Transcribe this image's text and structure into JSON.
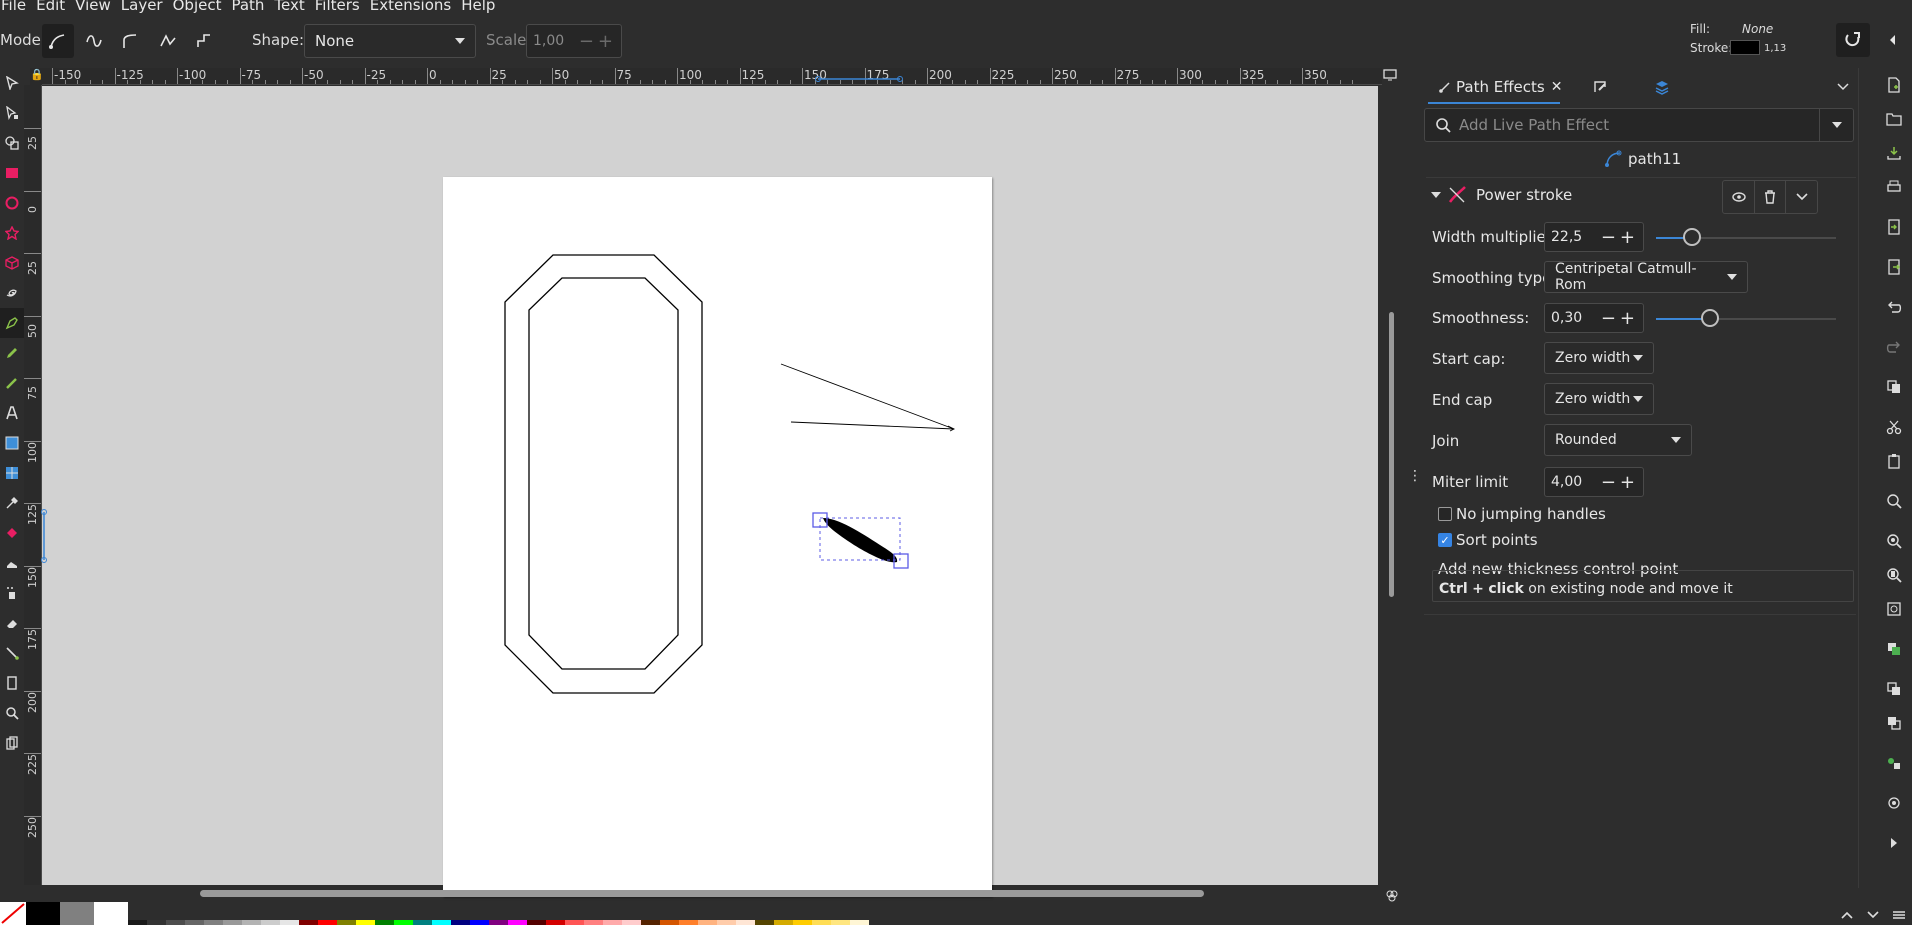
{
  "menu": [
    "File",
    "Edit",
    "View",
    "Layer",
    "Object",
    "Path",
    "Text",
    "Filters",
    "Extensions",
    "Help"
  ],
  "toolbar": {
    "mode_label": "Mode:",
    "shape_label": "Shape:",
    "shape_value": "None",
    "scale_label": "Scale:",
    "scale_value": "1,00",
    "fill_label": "Fill:",
    "fill_value": "None",
    "stroke_label": "Stroke:",
    "stroke_width": "1,13"
  },
  "ruler_top": [
    "-150",
    "-125",
    "-100",
    "-75",
    "-50",
    "-25",
    "0",
    "25",
    "50",
    "75",
    "100",
    "125",
    "150",
    "175",
    "200",
    "225",
    "250",
    "275",
    "300",
    "325",
    "350"
  ],
  "ruler_left": [
    "25",
    "0",
    "25",
    "50",
    "75",
    "100",
    "125",
    "150",
    "175",
    "200",
    "225",
    "250"
  ],
  "panel": {
    "tab_path_effects": "Path Effects",
    "search_placeholder": "Add Live Path Effect",
    "object_name": "path11",
    "effect_name": "Power stroke",
    "width_multiplier_label": "Width multiplier",
    "width_multiplier_value": "22,5",
    "width_multiplier_level": 0.2,
    "smoothing_type_label": "Smoothing type",
    "smoothing_type_value": "Centripetal Catmull-Rom",
    "smoothness_label": "Smoothness:",
    "smoothness_value": "0,30",
    "smoothness_level": 0.3,
    "start_cap_label": "Start cap:",
    "start_cap_value": "Zero width",
    "end_cap_label": "End cap",
    "end_cap_value": "Zero width",
    "join_label": "Join",
    "join_value": "Rounded",
    "miter_limit_label": "Miter limit",
    "miter_limit_value": "4,00",
    "no_jumping_label": "No jumping handles",
    "no_jumping_checked": false,
    "sort_points_label": "Sort points",
    "sort_points_checked": true,
    "help_title": "Add new thickness control point",
    "help_ctrl": "Ctrl",
    "help_plus": "+",
    "help_click": "click",
    "help_rest": "on existing node and move it"
  },
  "palette": [
    "#000000",
    "#808080",
    "#ffffff",
    "#1a1a1a",
    "#333333",
    "#4d4d4d",
    "#666666",
    "#808080",
    "#999999",
    "#b3b3b3",
    "#cccccc",
    "#e6e6e6",
    "#800000",
    "#ff0000",
    "#808000",
    "#ffff00",
    "#008000",
    "#00ff00",
    "#008080",
    "#00ffff",
    "#000080",
    "#0000ff",
    "#800080",
    "#ff00ff",
    "#550000",
    "#d40000",
    "#ff5555",
    "#ff8080",
    "#ffaaaa",
    "#ffcccc",
    "#552200",
    "#d45500",
    "#ff7f2a",
    "#ffb380",
    "#ffccaa",
    "#ffe6d5",
    "#554400",
    "#d4aa00",
    "#ffcc00",
    "#ffdd55",
    "#ffe680",
    "#fff6d5"
  ]
}
